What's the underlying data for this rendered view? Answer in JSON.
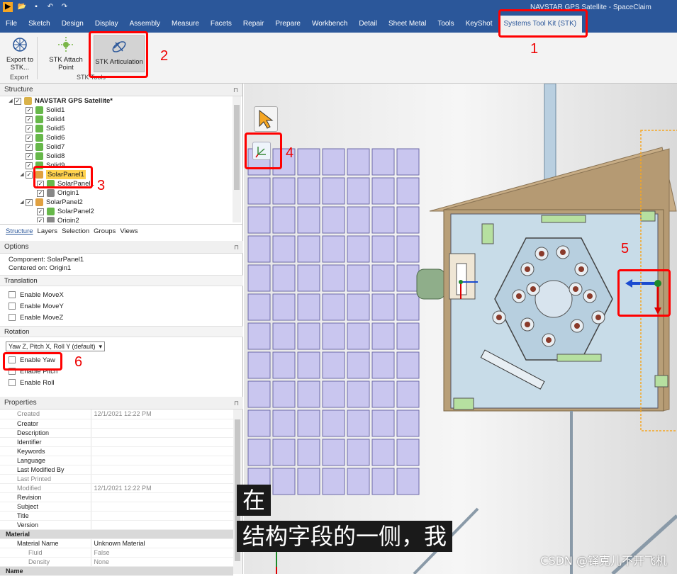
{
  "window": {
    "title": "NAVSTAR GPS Satellite - SpaceClaim",
    "app_icon": "spaceclaim-logo-icon"
  },
  "qat": [
    "folder-open-icon",
    "save-icon",
    "undo-icon",
    "redo-icon"
  ],
  "menu_tabs": [
    "File",
    "Sketch",
    "Design",
    "Display",
    "Assembly",
    "Measure",
    "Facets",
    "Repair",
    "Prepare",
    "Workbench",
    "Detail",
    "Sheet Metal",
    "Tools",
    "KeyShot",
    "Systems Tool Kit (STK)"
  ],
  "active_tab": "Systems Tool Kit (STK)",
  "ribbon": {
    "export_button": "Export to STK...",
    "export_group": "Export",
    "attach_point_button": "STK Attach Point",
    "articulation_button": "STK Articulation",
    "tools_group": "STK Tools"
  },
  "structure": {
    "title": "Structure",
    "tree": [
      {
        "label": "NAVSTAR GPS Satellite*",
        "depth": 0,
        "icon": "assembly-icon",
        "bold": true
      },
      {
        "label": "Solid1",
        "depth": 1,
        "icon": "solid-icon"
      },
      {
        "label": "Solid4",
        "depth": 1,
        "icon": "solid-icon"
      },
      {
        "label": "Solid5",
        "depth": 1,
        "icon": "solid-icon"
      },
      {
        "label": "Solid6",
        "depth": 1,
        "icon": "solid-icon"
      },
      {
        "label": "Solid7",
        "depth": 1,
        "icon": "solid-icon"
      },
      {
        "label": "Solid8",
        "depth": 1,
        "icon": "solid-icon"
      },
      {
        "label": "Solid9",
        "depth": 1,
        "icon": "solid-icon"
      },
      {
        "label": "SolarPanel1",
        "depth": 1,
        "icon": "component-icon",
        "selected": true
      },
      {
        "label": "SolarPanel1",
        "depth": 2,
        "icon": "solid-icon"
      },
      {
        "label": "Origin1",
        "depth": 2,
        "icon": "origin-icon"
      },
      {
        "label": "SolarPanel2",
        "depth": 1,
        "icon": "component-icon"
      },
      {
        "label": "SolarPanel2",
        "depth": 2,
        "icon": "solid-icon"
      },
      {
        "label": "Origin2",
        "depth": 2,
        "icon": "origin-icon"
      }
    ],
    "tabs": [
      "Structure",
      "Layers",
      "Selection",
      "Groups",
      "Views"
    ]
  },
  "options": {
    "title": "Options",
    "component": "Component: SolarPanel1",
    "centered_on": "Centered on: Origin1",
    "translation_title": "Translation",
    "translation": [
      "Enable MoveX",
      "Enable MoveY",
      "Enable MoveZ"
    ],
    "rotation_title": "Rotation",
    "rotation_order": "Yaw Z, Pitch X, Roll Y (default)",
    "rotation": [
      "Enable Yaw",
      "Enable Pitch",
      "Enable Roll"
    ]
  },
  "properties": {
    "title": "Properties",
    "rows": [
      {
        "k": "Created",
        "v": "12/1/2021 12:22 PM",
        "dim": true
      },
      {
        "k": "Creator",
        "v": ""
      },
      {
        "k": "Description",
        "v": ""
      },
      {
        "k": "Identifier",
        "v": ""
      },
      {
        "k": "Keywords",
        "v": ""
      },
      {
        "k": "Language",
        "v": ""
      },
      {
        "k": "Last Modified By",
        "v": ""
      },
      {
        "k": "Last Printed",
        "v": "",
        "dim": true
      },
      {
        "k": "Modified",
        "v": "12/1/2021 12:22 PM",
        "dim": true
      },
      {
        "k": "Revision",
        "v": ""
      },
      {
        "k": "Subject",
        "v": ""
      },
      {
        "k": "Title",
        "v": ""
      },
      {
        "k": "Version",
        "v": ""
      },
      {
        "k": "Material",
        "v": "",
        "cat": true
      },
      {
        "k": "Material Name",
        "v": "Unknown Material"
      },
      {
        "k": "Fluid",
        "v": "False",
        "sub": true,
        "dim": true
      },
      {
        "k": "Density",
        "v": "None",
        "sub": true,
        "dim": true
      },
      {
        "k": "Name",
        "v": "",
        "cat": true
      }
    ]
  },
  "annotations": [
    "1",
    "2",
    "3",
    "4",
    "5",
    "6"
  ],
  "subtitle": {
    "line1": "在",
    "line2": "结构字段的一侧，我"
  },
  "watermark": "CSDN @铎克儿不开飞机",
  "colors": {
    "accent": "#2b579a",
    "highlight": "#ff0000",
    "selection": "#ffd24d"
  }
}
